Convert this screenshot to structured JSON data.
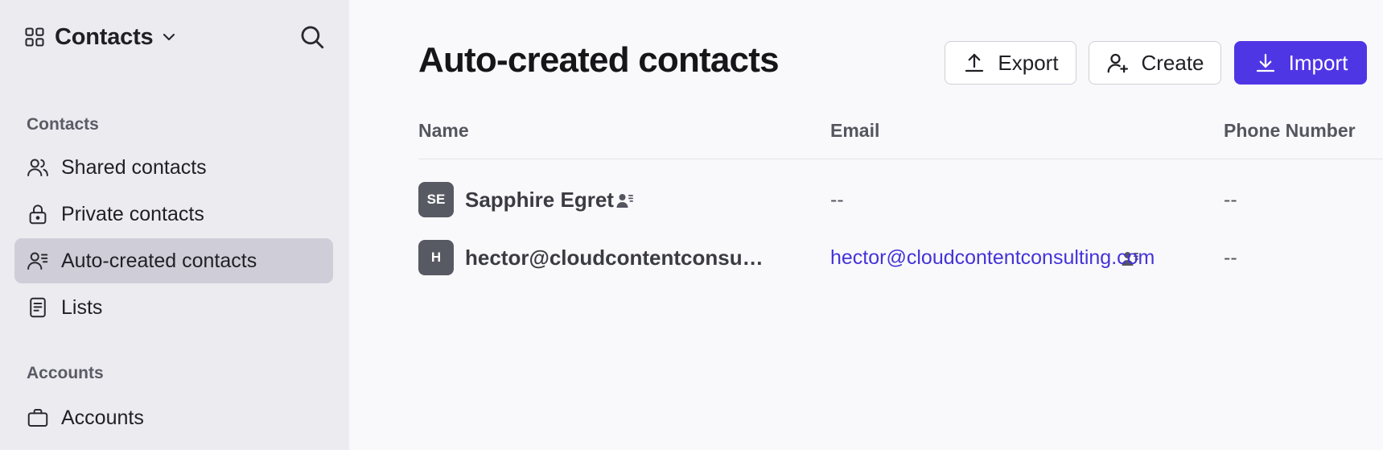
{
  "sidebar": {
    "workspace_title": "Contacts",
    "sections": [
      {
        "label": "Contacts",
        "items": [
          {
            "label": "Shared contacts",
            "icon": "users-icon"
          },
          {
            "label": "Private contacts",
            "icon": "lock-icon"
          },
          {
            "label": "Auto-created contacts",
            "icon": "auto-contacts-icon",
            "active": true
          },
          {
            "label": "Lists",
            "icon": "list-doc-icon"
          }
        ]
      },
      {
        "label": "Accounts",
        "items": [
          {
            "label": "Accounts",
            "icon": "briefcase-icon"
          }
        ]
      }
    ]
  },
  "main": {
    "title": "Auto-created contacts",
    "buttons": {
      "export": "Export",
      "create": "Create",
      "import": "Import"
    },
    "table": {
      "columns": [
        "Name",
        "Email",
        "Phone Number"
      ],
      "rows": [
        {
          "initials": "SE",
          "name": "Sapphire Egret",
          "email": "--",
          "phone": "--"
        },
        {
          "initials": "H",
          "name": "hector@cloudcontentconsu…",
          "email": "hector@cloudcontentconsulting.com",
          "phone": "--"
        }
      ]
    }
  },
  "colors": {
    "accent": "#4f36e5",
    "link": "#4433d6",
    "sidebar_bg": "#ecebf0",
    "active_item_bg": "#cfced8",
    "avatar_bg": "#585a63"
  }
}
